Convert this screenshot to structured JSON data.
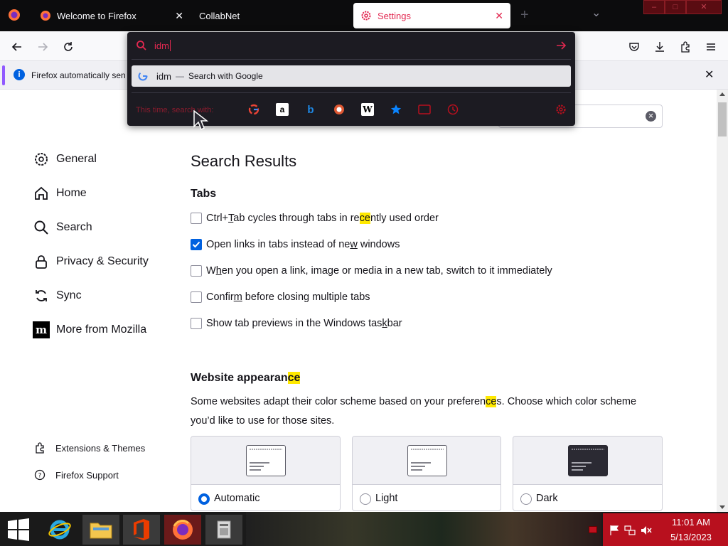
{
  "tabs": [
    {
      "title": "Welcome to Firefox",
      "close": "✕"
    },
    {
      "title": "CollabNet",
      "close": "✕"
    },
    {
      "title": "Settings",
      "close": "✕"
    }
  ],
  "tabstrip": {
    "new_tab": "+",
    "list_all": "⌄"
  },
  "notification": {
    "text": "Firefox automatically sen",
    "close": "✕"
  },
  "url_panel": {
    "typed": "idm",
    "result_query": "idm",
    "result_sep": "—",
    "result_label": "Search with Google",
    "this_time_label": "This time, search with:"
  },
  "search_field": {
    "clear": "×"
  },
  "sidebar": {
    "items": [
      {
        "label": "General"
      },
      {
        "label": "Home"
      },
      {
        "label": "Search"
      },
      {
        "label": "Privacy & Security"
      },
      {
        "label": "Sync"
      },
      {
        "label": "More from Mozilla"
      }
    ],
    "footer": [
      {
        "label": "Extensions & Themes"
      },
      {
        "label": "Firefox Support"
      }
    ]
  },
  "main": {
    "heading": "Search Results",
    "tabs_section": {
      "title": "Tabs",
      "options": [
        {
          "a": "Ctrl+",
          "b": "T",
          "c": "ab cycles through tabs in re",
          "d": "ce",
          "e": "ntly used order",
          "checked": false
        },
        {
          "a": "Open links in tabs instead of ne",
          "b": "w",
          "c": " windows",
          "checked": true
        },
        {
          "a": "W",
          "b": "h",
          "c": "en you open a link, image or media in a new tab, switch to it immediately",
          "checked": false
        },
        {
          "a": "Confir",
          "b": "m",
          "c": " before closing multiple tabs",
          "checked": false
        },
        {
          "a": "Show tab previews in the Windows tas",
          "b": "k",
          "c": "bar",
          "checked": false
        }
      ]
    },
    "website_appearance": {
      "title_a": "Website appearan",
      "title_b": "ce",
      "desc_a": "Some websites adapt their color scheme based on your preferen",
      "desc_b": "ce",
      "desc_c": "s. Choose which color scheme",
      "desc_d": "you’d like to use for those sites.",
      "themes": [
        {
          "label": "Automatic",
          "selected": true
        },
        {
          "label": "Light",
          "selected": false
        },
        {
          "label": "Dark",
          "selected": false
        }
      ]
    }
  },
  "taskbar": {
    "time": "11:01 AM",
    "date": "5/13/2023"
  },
  "colors": {
    "accent": "#e22850",
    "checkbox_blue": "#0061e0",
    "highlight": "#ffe900",
    "tray": "#b8101e"
  }
}
